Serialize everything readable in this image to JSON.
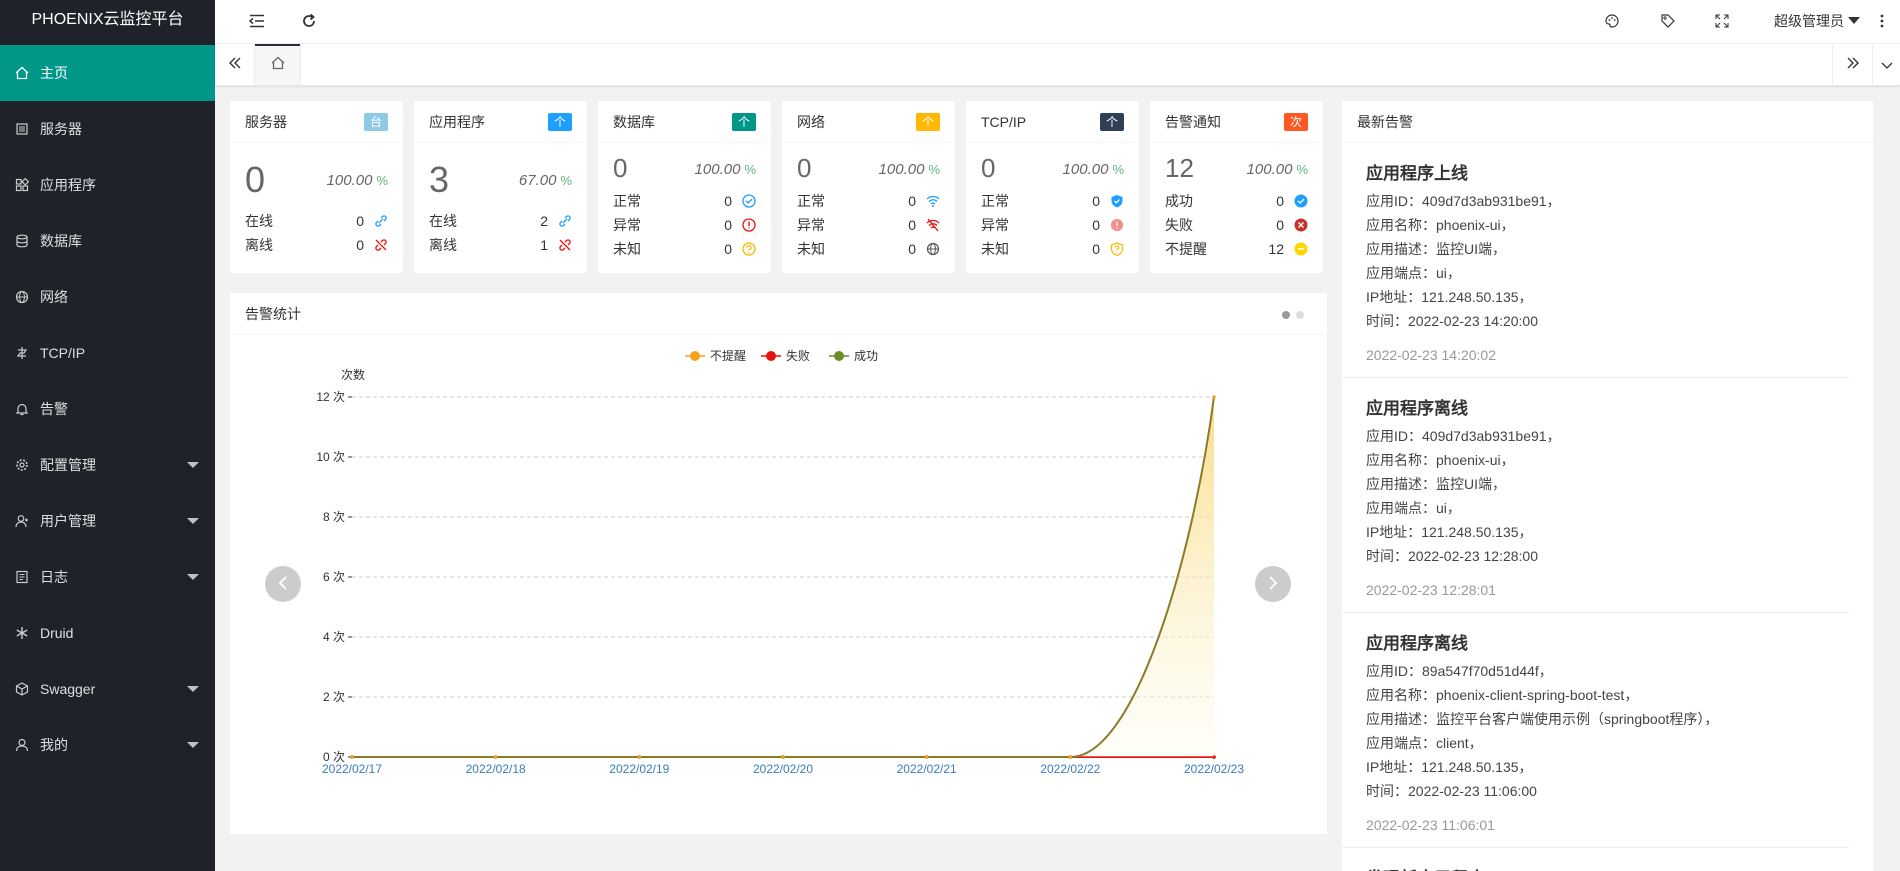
{
  "app": {
    "title": "PHOENIX云监控平台"
  },
  "sidebar": {
    "items": [
      {
        "label": "主页",
        "icon": "home-icon",
        "active": true,
        "has_children": false
      },
      {
        "label": "服务器",
        "icon": "server-icon",
        "has_children": false
      },
      {
        "label": "应用程序",
        "icon": "apps-icon",
        "has_children": false
      },
      {
        "label": "数据库",
        "icon": "database-icon",
        "has_children": false
      },
      {
        "label": "网络",
        "icon": "globe-icon",
        "has_children": false
      },
      {
        "label": "TCP/IP",
        "icon": "tcp-icon",
        "has_children": false
      },
      {
        "label": "告警",
        "icon": "bell-icon",
        "has_children": false
      },
      {
        "label": "配置管理",
        "icon": "gear-icon",
        "has_children": true
      },
      {
        "label": "用户管理",
        "icon": "user-manage-icon",
        "has_children": true
      },
      {
        "label": "日志",
        "icon": "log-icon",
        "has_children": true
      },
      {
        "label": "Druid",
        "icon": "druid-icon",
        "has_children": false
      },
      {
        "label": "Swagger",
        "icon": "cube-icon",
        "has_children": true
      },
      {
        "label": "我的",
        "icon": "person-icon",
        "has_children": true
      }
    ]
  },
  "header": {
    "user_label": "超级管理员"
  },
  "cards": [
    {
      "title": "服务器",
      "badge": "台",
      "badge_color": "#8ecae6",
      "total": "0",
      "percent": "100.00",
      "pct_sign": "%",
      "rows": [
        {
          "label": "在线",
          "value": "0"
        },
        {
          "label": "离线",
          "value": "0"
        }
      ]
    },
    {
      "title": "应用程序",
      "badge": "个",
      "badge_color": "#1E9FFF",
      "total": "3",
      "percent": "67.00",
      "pct_sign": "%",
      "rows": [
        {
          "label": "在线",
          "value": "2"
        },
        {
          "label": "离线",
          "value": "1"
        }
      ]
    },
    {
      "title": "数据库",
      "badge": "个",
      "badge_color": "#009688",
      "total": "0",
      "percent": "100.00",
      "pct_sign": "%",
      "rows": [
        {
          "label": "正常",
          "value": "0"
        },
        {
          "label": "异常",
          "value": "0"
        },
        {
          "label": "未知",
          "value": "0"
        }
      ]
    },
    {
      "title": "网络",
      "badge": "个",
      "badge_color": "#FFB800",
      "total": "0",
      "percent": "100.00",
      "pct_sign": "%",
      "rows": [
        {
          "label": "正常",
          "value": "0"
        },
        {
          "label": "异常",
          "value": "0"
        },
        {
          "label": "未知",
          "value": "0"
        }
      ]
    },
    {
      "title": "TCP/IP",
      "badge": "个",
      "badge_color": "#2F4056",
      "total": "0",
      "percent": "100.00",
      "pct_sign": "%",
      "rows": [
        {
          "label": "正常",
          "value": "0"
        },
        {
          "label": "异常",
          "value": "0"
        },
        {
          "label": "未知",
          "value": "0"
        }
      ]
    },
    {
      "title": "告警通知",
      "badge": "次",
      "badge_color": "#FF5722",
      "total": "12",
      "percent": "100.00",
      "pct_sign": "%",
      "rows": [
        {
          "label": "成功",
          "value": "0"
        },
        {
          "label": "失败",
          "value": "0"
        },
        {
          "label": "不提醒",
          "value": "12"
        }
      ]
    }
  ],
  "chart_panel": {
    "title": "告警统计"
  },
  "chart_data": {
    "type": "line",
    "categories": [
      "2022/02/17",
      "2022/02/18",
      "2022/02/19",
      "2022/02/20",
      "2022/02/21",
      "2022/02/22",
      "2022/02/23"
    ],
    "series": [
      {
        "name": "不提醒",
        "color": "#f7a21b",
        "values": [
          0,
          0,
          0,
          0,
          0,
          0,
          12
        ]
      },
      {
        "name": "失败",
        "color": "#e8110f",
        "values": [
          0,
          0,
          0,
          0,
          0,
          0,
          0
        ]
      },
      {
        "name": "成功",
        "color": "#6b8e23",
        "values": [
          0,
          0,
          0,
          0,
          0,
          0,
          0
        ]
      }
    ],
    "ylabel": "次数",
    "ylim": [
      0,
      12
    ],
    "yticks": [
      0,
      2,
      4,
      6,
      8,
      10,
      12
    ],
    "ytick_labels": [
      "0 次",
      "2 次",
      "4 次",
      "6 次",
      "8 次",
      "10 次",
      "12 次"
    ],
    "grid": true,
    "legend": "top-center"
  },
  "alerts_panel": {
    "title": "最新告警",
    "items": [
      {
        "title": "应用程序上线",
        "lines": [
          "应用ID：409d7d3ab931be91，",
          "应用名称：phoenix-ui，",
          "应用描述：监控UI端，",
          "应用端点：ui，",
          "IP地址：121.248.50.135，",
          "时间：2022-02-23 14:20:00"
        ],
        "time": "2022-02-23 14:20:02"
      },
      {
        "title": "应用程序离线",
        "lines": [
          "应用ID：409d7d3ab931be91，",
          "应用名称：phoenix-ui，",
          "应用描述：监控UI端，",
          "应用端点：ui，",
          "IP地址：121.248.50.135，",
          "时间：2022-02-23 12:28:00"
        ],
        "time": "2022-02-23 12:28:01"
      },
      {
        "title": "应用程序离线",
        "lines": [
          "应用ID：89a547f70d51d44f，",
          "应用名称：phoenix-client-spring-boot-test，",
          "应用描述：监控平台客户端使用示例（springboot程序），",
          "应用端点：client，",
          "IP地址：121.248.50.135，",
          "时间：2022-02-23 11:06:00"
        ],
        "time": "2022-02-23 11:06:01"
      },
      {
        "title": "发现新应用程序",
        "lines": [],
        "time": ""
      }
    ]
  }
}
